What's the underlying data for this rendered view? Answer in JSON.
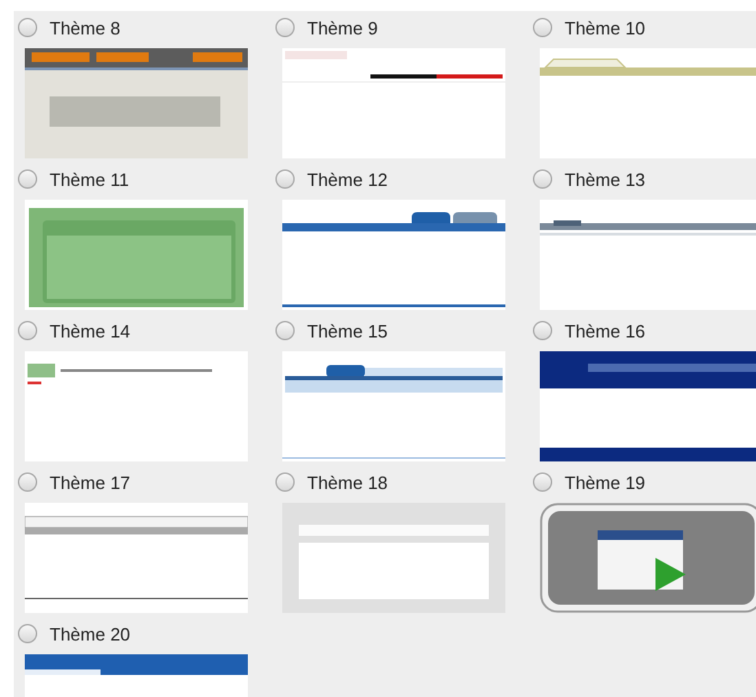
{
  "themes": [
    {
      "label": "Thème 8",
      "selected": false,
      "kind": "orange"
    },
    {
      "label": "Thème 9",
      "selected": false,
      "kind": "redblack"
    },
    {
      "label": "Thème 10",
      "selected": false,
      "kind": "olive"
    },
    {
      "label": "Thème 11",
      "selected": false,
      "kind": "green"
    },
    {
      "label": "Thème 12",
      "selected": false,
      "kind": "bluetabs"
    },
    {
      "label": "Thème 13",
      "selected": false,
      "kind": "greytabs"
    },
    {
      "label": "Thème 14",
      "selected": false,
      "kind": "greenbar"
    },
    {
      "label": "Thème 15",
      "selected": false,
      "kind": "lightblue"
    },
    {
      "label": "Thème 16",
      "selected": false,
      "kind": "navy"
    },
    {
      "label": "Thème 17",
      "selected": false,
      "kind": "classic"
    },
    {
      "label": "Thème 18",
      "selected": false,
      "kind": "grey"
    },
    {
      "label": "Thème 19",
      "selected": false,
      "kind": "icon"
    },
    {
      "label": "Thème 20",
      "selected": false,
      "kind": "bluebanner"
    }
  ]
}
